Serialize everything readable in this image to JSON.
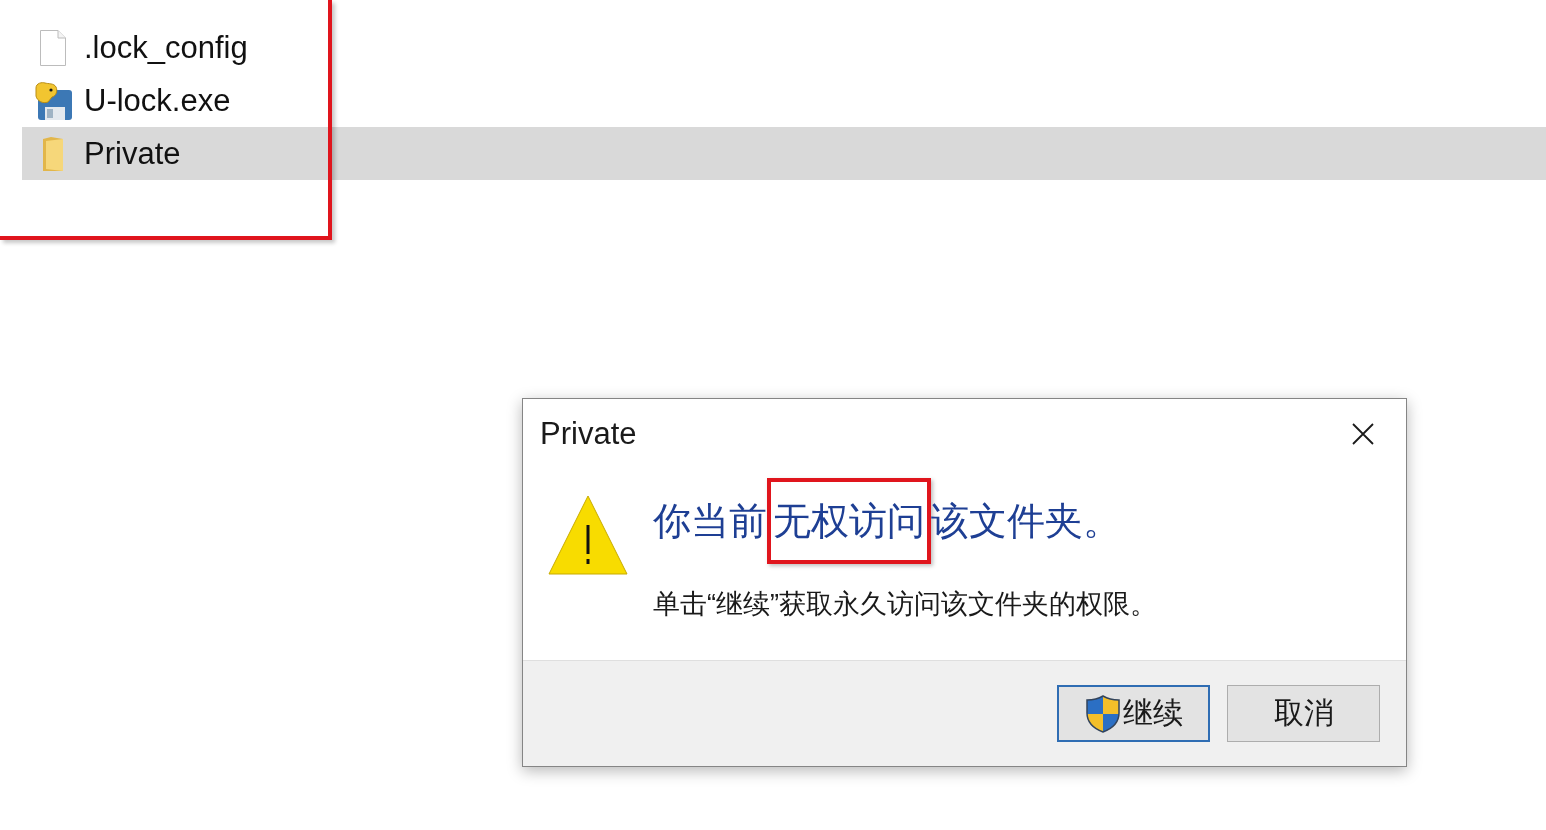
{
  "file_list": {
    "highlighted": true,
    "items": [
      {
        "name": ".lock_config",
        "kind": "file",
        "selected": false
      },
      {
        "name": "U-lock.exe",
        "kind": "program",
        "selected": false
      },
      {
        "name": "Private",
        "kind": "folder",
        "selected": true
      }
    ]
  },
  "dialog": {
    "title": "Private",
    "heading": [
      {
        "text": "你当前",
        "highlighted": false
      },
      {
        "text": "无权访问",
        "highlighted": true
      },
      {
        "text": "该文件夹。",
        "highlighted": false
      }
    ],
    "message": "单击“继续”获取永久访问该文件夹的权限。",
    "buttons": [
      {
        "label": "继续",
        "kind": "elevated",
        "default": true
      },
      {
        "label": "取消",
        "kind": "plain",
        "default": false
      }
    ]
  }
}
